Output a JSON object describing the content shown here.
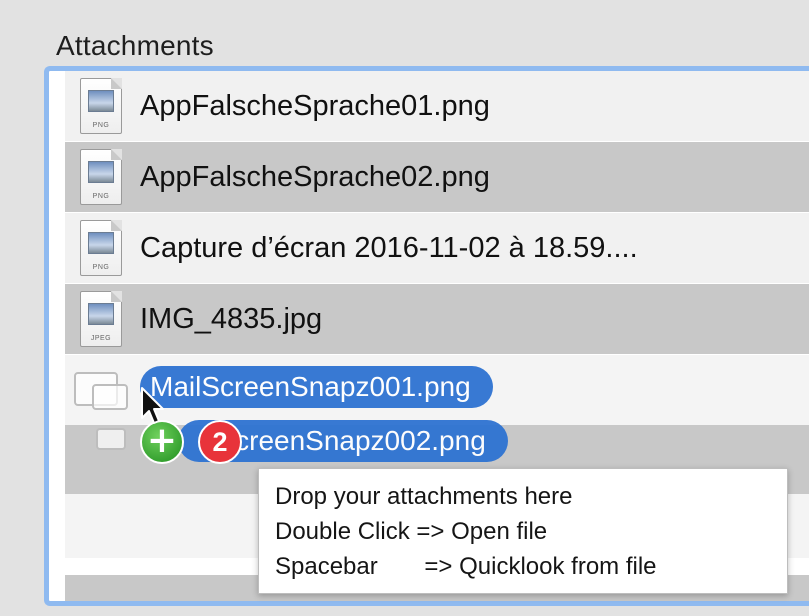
{
  "section": {
    "label": "Attachments"
  },
  "attachments": [
    {
      "name": "AppFalscheSprache01.png",
      "type": "PNG",
      "icon": "png-file-icon"
    },
    {
      "name": "AppFalscheSprache02.png",
      "type": "PNG",
      "icon": "png-file-icon"
    },
    {
      "name": "Capture d’écran 2016-11-02 à 18.59....",
      "type": "PNG",
      "icon": "png-file-icon"
    },
    {
      "name": "IMG_4835.jpg",
      "type": "JPEG",
      "icon": "jpeg-file-icon"
    }
  ],
  "drag": {
    "items": [
      "MailScreenSnapz001.png",
      "ilScreenSnapz002.png"
    ],
    "count": "2",
    "plus": "+"
  },
  "tooltip": {
    "lines": [
      "Drop your attachments here",
      "Double Click => Open file",
      "Spacebar       => Quicklook from file"
    ]
  },
  "colors": {
    "focus_ring": "#8fbaf0",
    "row_alt": "#c8c8c8",
    "drag_pill": "#2e73d2",
    "badge_plus": "#1f8f1f",
    "badge_count": "#e8333a"
  }
}
